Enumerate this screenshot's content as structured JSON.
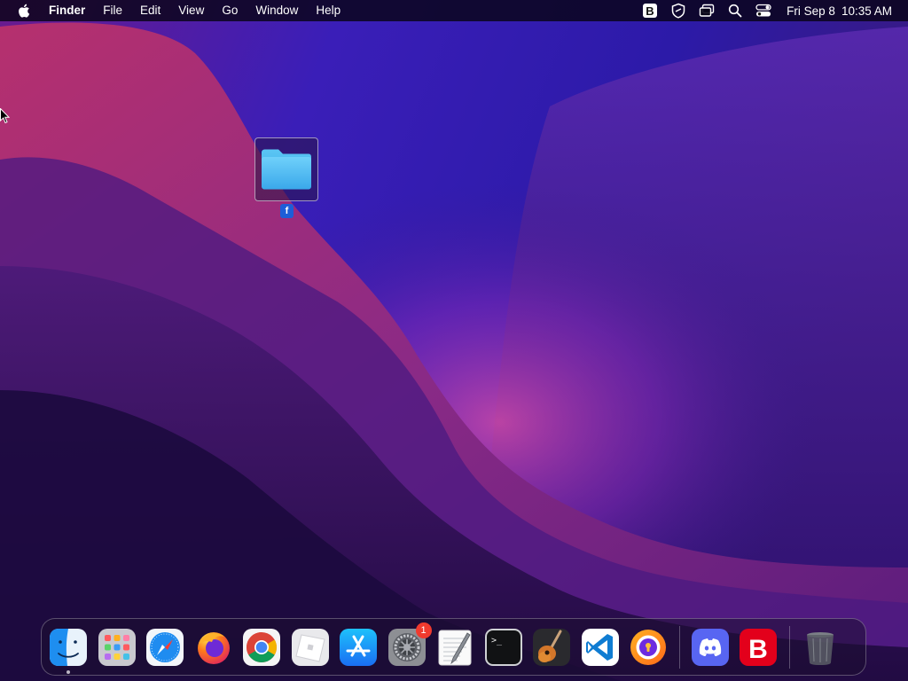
{
  "menubar": {
    "apple_icon": "apple-logo-icon",
    "app_name": "Finder",
    "menus": [
      "File",
      "Edit",
      "View",
      "Go",
      "Window",
      "Help"
    ],
    "tray_icons": [
      "bitwarden-b-icon",
      "vpn-shield-icon",
      "screen-mirroring-icon",
      "spotlight-search-icon",
      "control-center-icon"
    ],
    "date": "Fri Sep 8",
    "time": "10:35 AM"
  },
  "desktop": {
    "folder": {
      "icon": "folder-icon",
      "label": "f",
      "selected": true
    }
  },
  "dock": {
    "apps": [
      {
        "name": "Finder",
        "icon": "finder-icon",
        "running": true
      },
      {
        "name": "Launchpad",
        "icon": "launchpad-icon"
      },
      {
        "name": "Safari",
        "icon": "safari-icon"
      },
      {
        "name": "Firefox",
        "icon": "firefox-icon"
      },
      {
        "name": "Google Chrome",
        "icon": "chrome-icon"
      },
      {
        "name": "Roblox",
        "icon": "roblox-icon"
      },
      {
        "name": "App Store",
        "icon": "app-store-icon"
      },
      {
        "name": "System Preferences",
        "icon": "system-preferences-icon",
        "badge": "1"
      },
      {
        "name": "TextEdit",
        "icon": "textedit-icon"
      },
      {
        "name": "Terminal",
        "icon": "terminal-icon"
      },
      {
        "name": "GarageBand",
        "icon": "garageband-icon"
      },
      {
        "name": "Visual Studio Code",
        "icon": "vscode-icon"
      },
      {
        "name": "Avast Secure Browser",
        "icon": "avast-browser-icon"
      },
      {
        "name": "Discord",
        "icon": "discord-icon"
      },
      {
        "name": "Bitdefender",
        "icon": "bitdefender-icon"
      },
      {
        "name": "Trash",
        "icon": "trash-icon"
      }
    ]
  },
  "colors": {
    "wallpaper_base": "#2a0f63",
    "accent_magenta": "#b02d7a",
    "folder_blue": "#3fb5ee",
    "selection_blue": "#1d5ed8",
    "badge_red": "#f03a2e"
  }
}
